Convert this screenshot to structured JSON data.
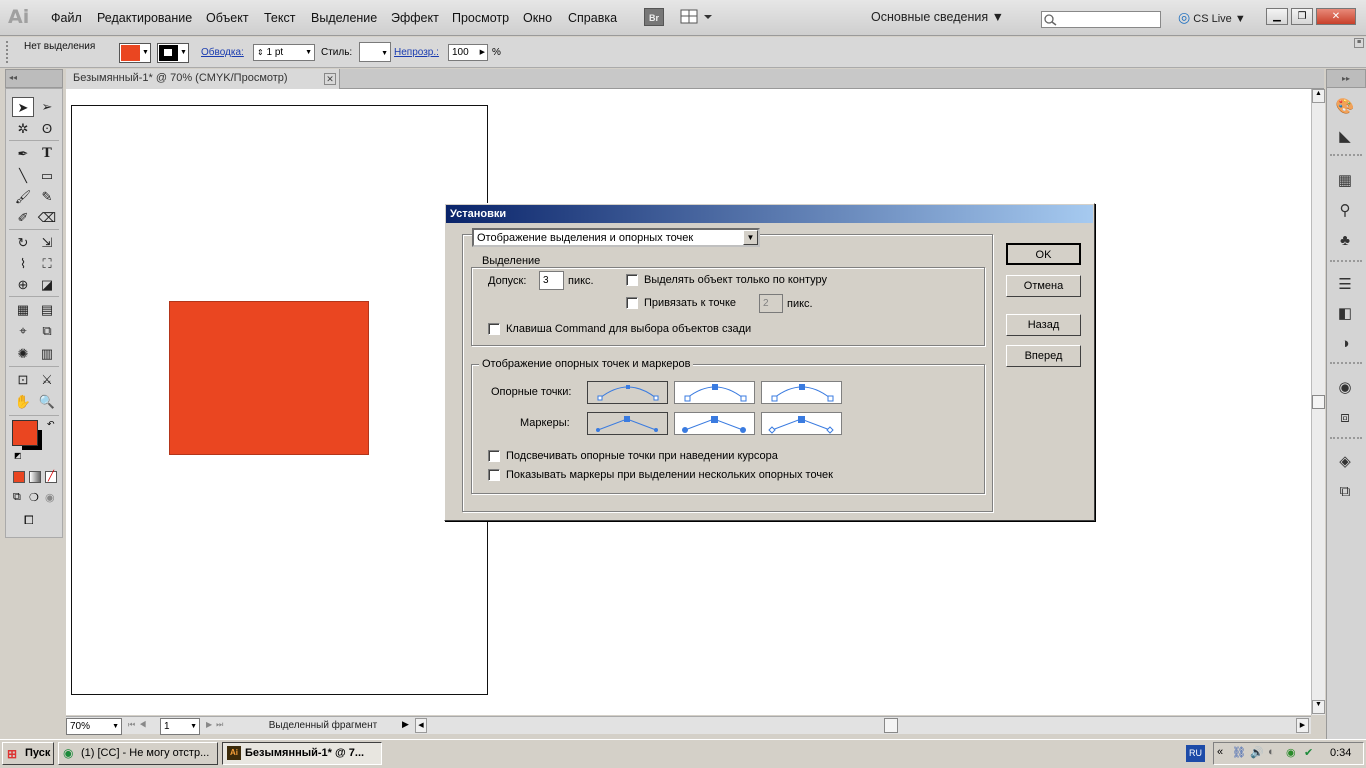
{
  "app": {
    "logo": "Ai"
  },
  "menu": [
    "Файл",
    "Редактирование",
    "Объект",
    "Текст",
    "Выделение",
    "Эффект",
    "Просмотр",
    "Окно",
    "Справка"
  ],
  "topbar": {
    "bridge": "Br",
    "workspace": "Основные сведения",
    "cs_live": "CS Live"
  },
  "control": {
    "no_selection": "Нет выделения",
    "stroke_link": "Обводка:",
    "stroke_weight": "1 pt",
    "style_label": "Стиль:",
    "opacity_link": "Непрозр.:",
    "opacity_value": "100",
    "opacity_unit": "%"
  },
  "document": {
    "tab_title": "Безымянный-1* @ 70% (CMYK/Просмотр)",
    "tab_close": "✕"
  },
  "colors": {
    "fill": "#ea4621",
    "rect": "#ea4621"
  },
  "statusbar": {
    "zoom": "70%",
    "page": "1",
    "status": "Выделенный фрагмент"
  },
  "dialog": {
    "title": "Установки",
    "section_select": "Отображение выделения и опорных точек",
    "selection_group": "Выделение",
    "tolerance_label": "Допуск:",
    "tolerance_value": "3",
    "tolerance_unit": "пикс.",
    "opt_path_only": "Выделять объект только по контуру",
    "opt_snap": "Привязать к точке",
    "snap_value": "2",
    "snap_unit": "пикс.",
    "opt_command": "Клавиша Command для выбора объектов сзади",
    "anchor_group": "Отображение опорных точек и маркеров",
    "anchors_label": "Опорные точки:",
    "handles_label": "Маркеры:",
    "opt_highlight": "Подсвечивать опорные точки при наведении курсора",
    "opt_show_handles": "Показывать маркеры при выделении нескольких опорных точек",
    "buttons": {
      "ok": "OK",
      "cancel": "Отмена",
      "back": "Назад",
      "forward": "Вперед"
    }
  },
  "taskbar": {
    "start": "Пуск",
    "task1": "(1) [CC] - Не могу отстр...",
    "task2": "Безымянный-1* @ 7...",
    "lang": "RU",
    "clock": "0:34"
  }
}
